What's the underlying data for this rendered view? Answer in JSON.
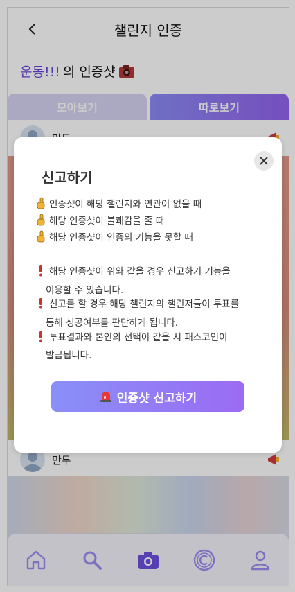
{
  "header": {
    "title": "챌린지 인증",
    "back_icon": "chevron-left-icon"
  },
  "page_heading": {
    "highlight": "운동!!!",
    "rest": " 의 인증샷"
  },
  "tabs": [
    {
      "label": "모아보기",
      "active": false
    },
    {
      "label": "따로보기",
      "active": true
    }
  ],
  "posts": [
    {
      "username": "만두"
    },
    {
      "username": "만두"
    }
  ],
  "modal": {
    "title": "신고하기",
    "reasons": [
      "인증샷이 해당 챌린지와 연관이 없을 때",
      "해당 인증샷이 불쾌감을 줄 때",
      "해당 인증샷이 인증의 기능을 못할 때"
    ],
    "notices": [
      [
        "해당 인증샷이 위와 같을 경우 신고하기 기능을",
        "이용할 수 있습니다."
      ],
      [
        "신고를 할 경우 해당 챌린지의 챌린저들이 투표를",
        "통해 성공여부를 판단하게 됩니다."
      ],
      [
        "투표결과와 본인의 선택이 같을 시 패스코인이",
        "발급됩니다."
      ]
    ],
    "button_label": "인증샷 신고하기"
  },
  "colors": {
    "accent": "#9463ee",
    "highlight": "#6a44d8"
  },
  "bottom_nav": [
    "home-icon",
    "search-icon",
    "camera-icon",
    "coin-icon",
    "profile-icon"
  ]
}
